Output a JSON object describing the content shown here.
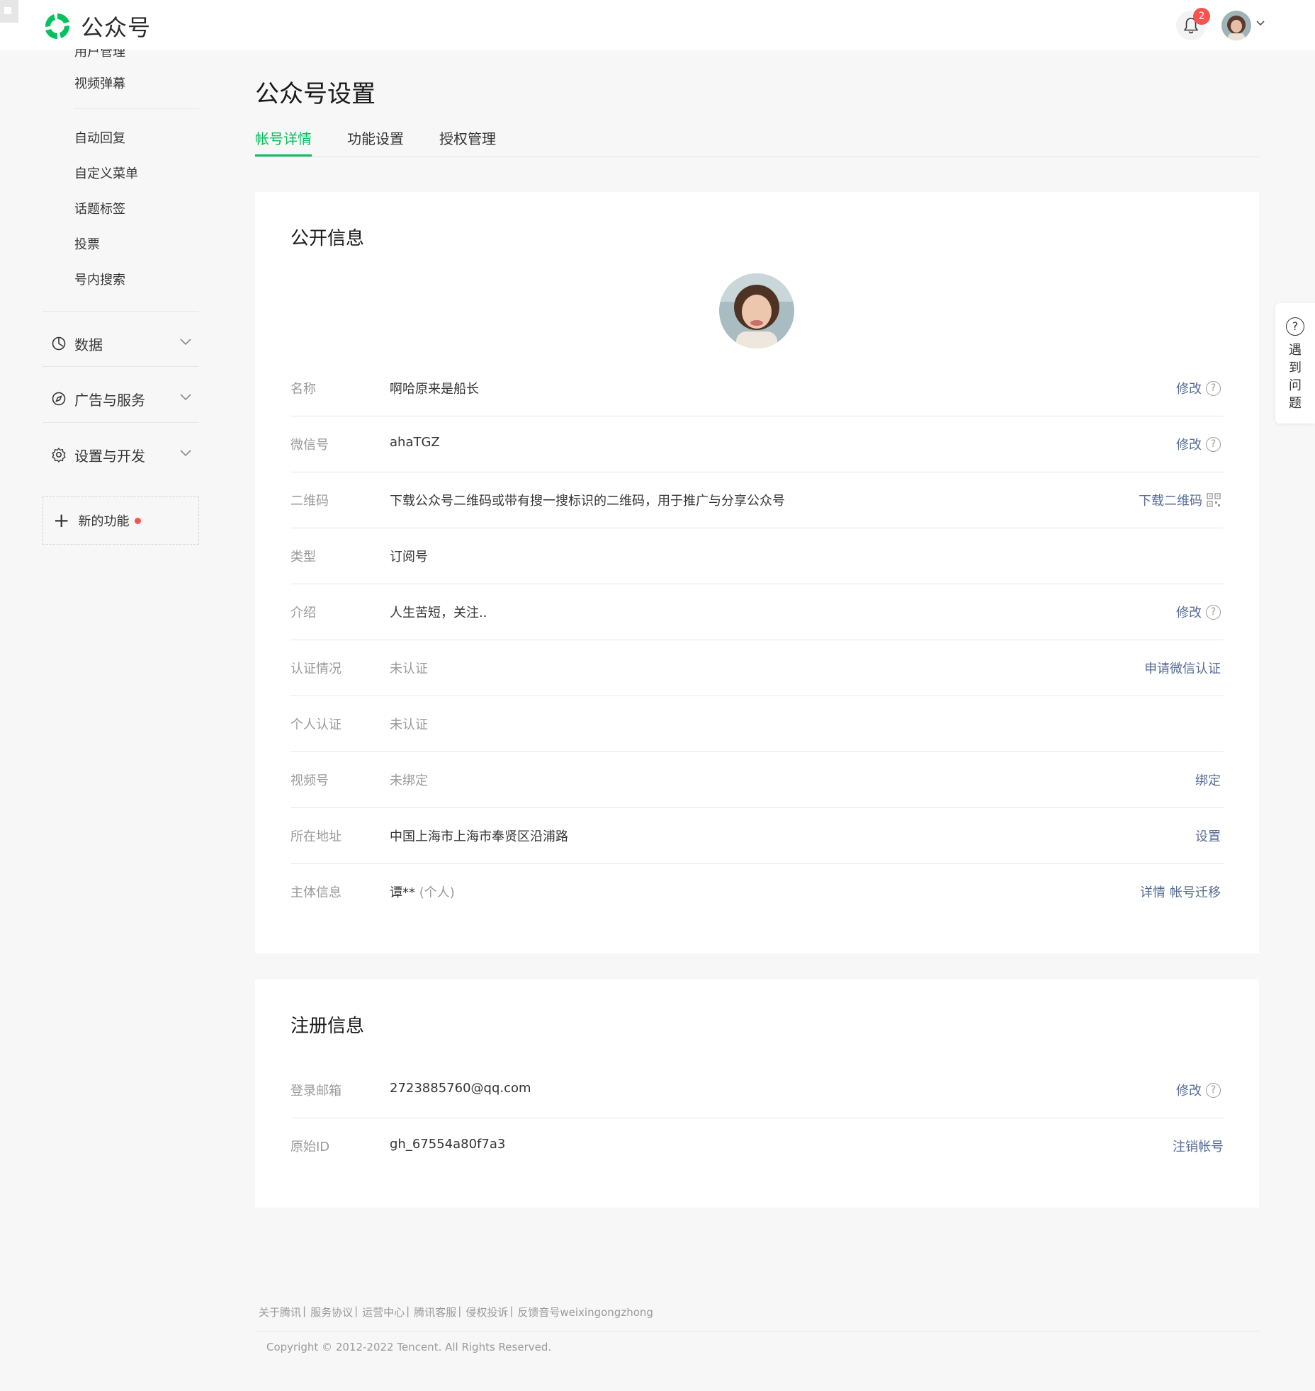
{
  "header": {
    "app_name": "公众号",
    "notification_count": "2"
  },
  "sidebar": {
    "partial_item": "用户管理",
    "items_top": [
      "视频弹幕"
    ],
    "items": [
      "自动回复",
      "自定义菜单",
      "话题标签",
      "投票",
      "号内搜索"
    ],
    "groups": [
      {
        "label": "数据",
        "icon": "chart-icon"
      },
      {
        "label": "广告与服务",
        "icon": "compass-icon"
      },
      {
        "label": "设置与开发",
        "icon": "gear-icon"
      }
    ],
    "new_feature": "新的功能"
  },
  "main": {
    "title": "公众号设置",
    "tabs": [
      "帐号详情",
      "功能设置",
      "授权管理"
    ],
    "active_tab": "帐号详情"
  },
  "public_info": {
    "title": "公开信息",
    "rows": [
      {
        "label": "名称",
        "value": "啊哈原来是船长",
        "action": "修改"
      },
      {
        "label": "微信号",
        "value": "ahaTGZ",
        "action": "修改"
      },
      {
        "label": "二维码",
        "value": "下载公众号二维码或带有搜一搜标识的二维码，用于推广与分享公众号",
        "action": "下载二维码"
      },
      {
        "label": "类型",
        "value": "订阅号"
      },
      {
        "label": "介绍",
        "value": "人生苦短，关注..",
        "action": "修改"
      },
      {
        "label": "认证情况",
        "value": "未认证",
        "action": "申请微信认证"
      },
      {
        "label": "个人认证",
        "value": "未认证"
      },
      {
        "label": "视频号",
        "value": "未绑定",
        "action": "绑定"
      },
      {
        "label": "所在地址",
        "value": "中国上海市上海市奉贤区沿浦路",
        "action": "设置"
      },
      {
        "label": "主体信息",
        "value": "谭**",
        "value_sub": "(个人)",
        "action": "详情",
        "action2": "帐号迁移"
      }
    ]
  },
  "register_info": {
    "title": "注册信息",
    "rows": [
      {
        "label": "登录邮箱",
        "value": "2723885760@qq.com",
        "action": "修改"
      },
      {
        "label": "原始ID",
        "value": "gh_67554a80f7a3",
        "action": "注销帐号"
      }
    ]
  },
  "help": {
    "label": [
      "遇",
      "到",
      "问",
      "题"
    ]
  },
  "footer": {
    "links": [
      "关于腾讯",
      "服务协议",
      "运营中心",
      "腾讯客服",
      "侵权投诉",
      "反馈音号weixingongzhong"
    ],
    "separator": "|",
    "copyright": "Copyright © 2012-2022 Tencent. All Rights Reserved."
  },
  "colors": {
    "brand_green": "#07c160",
    "link_blue": "#576b95",
    "badge_red": "#fa5151"
  }
}
